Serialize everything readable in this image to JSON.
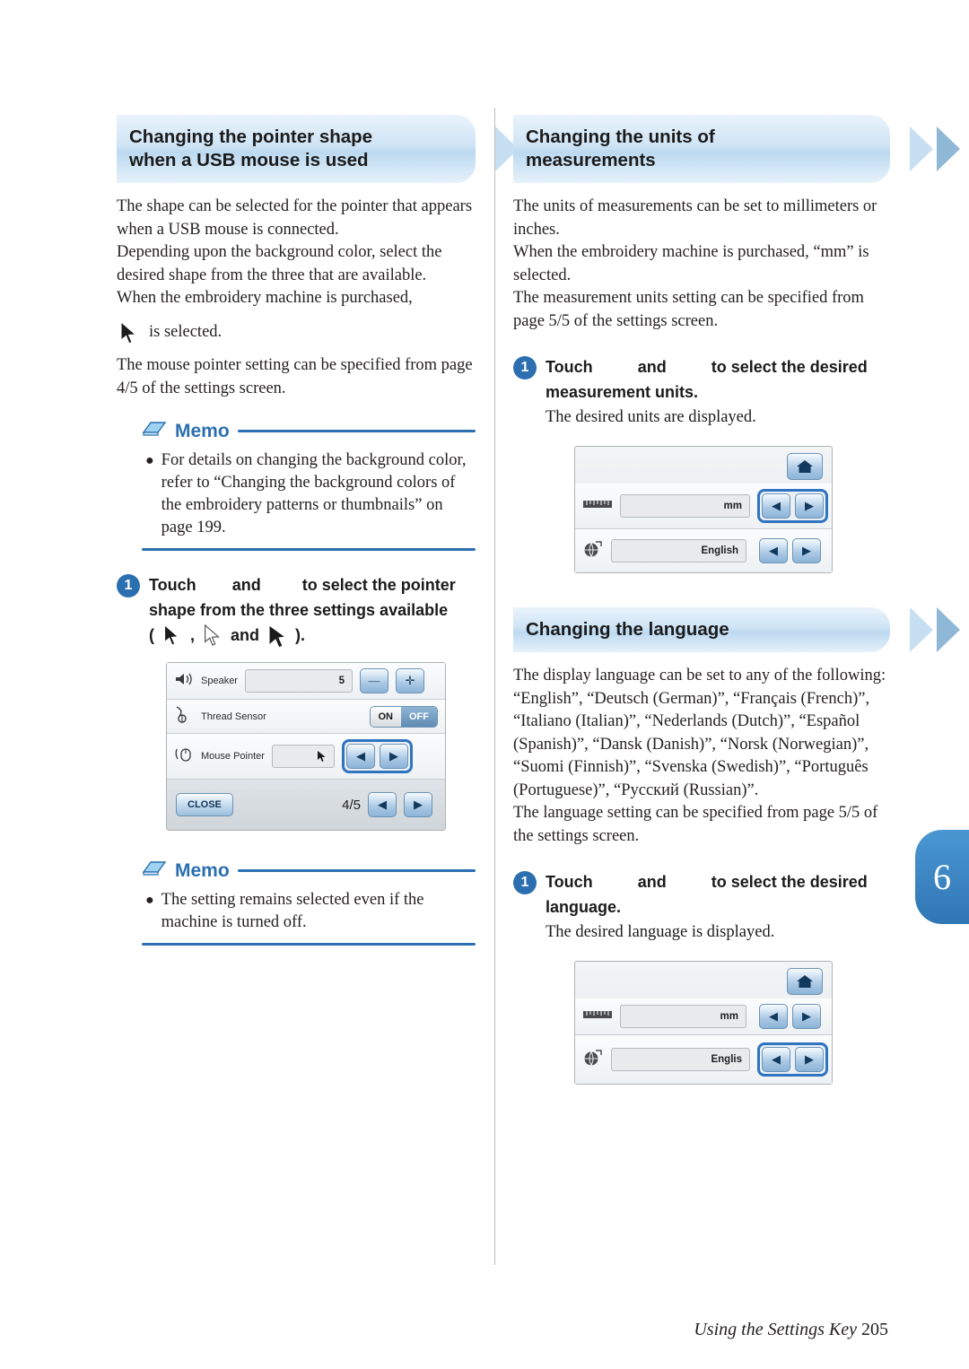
{
  "page": {
    "number": "6",
    "footer_text": "Using the Settings Key",
    "footer_page": "205"
  },
  "left_column": {
    "heading_line1": "Changing the pointer shape",
    "heading_line2": "when a USB mouse is used",
    "paragraphs": [
      "The shape can be selected for the pointer that appears when a USB mouse is connected.",
      "Depending upon the background color, select the desired shape from the three that are available.",
      "When the embroidery machine is purchased,"
    ],
    "is_selected_text": "is selected.",
    "paragraph_after": "The mouse pointer setting can be specified from page 4/5 of the settings screen.",
    "memo1": {
      "title": "Memo",
      "bullet": "For details on changing the background color, refer to “Changing the background colors of the embroidery patterns or thumbnails” on page 199."
    },
    "step1": {
      "number": "1",
      "text_a": "Touch",
      "text_b": "and",
      "text_c": "to select the pointer",
      "text_d": "shape from the three settings available",
      "paren_open": "(",
      "comma": ",",
      "and_word": "and",
      "paren_close": ")."
    },
    "lcd": {
      "rows": [
        {
          "icon": "speaker-icon",
          "label": "Speaker",
          "value": "5",
          "control": "minus-plus"
        },
        {
          "icon": "thread-sensor-icon",
          "label": "Thread Sensor",
          "control": "on-off",
          "on_label": "ON",
          "off_label": "OFF"
        },
        {
          "icon": "mouse-pointer-icon",
          "label": "Mouse Pointer",
          "control": "arrows"
        }
      ],
      "close_label": "CLOSE",
      "page_indicator": "4/5"
    },
    "memo2": {
      "title": "Memo",
      "bullet": "The setting remains selected even if the machine is turned off."
    }
  },
  "right_column": {
    "units_section": {
      "heading_line1": "Changing the units of",
      "heading_line2": "measurements",
      "paragraphs": [
        "The units of measurements can be set to millimeters or inches.",
        "When the embroidery machine is purchased, “mm” is selected.",
        "The measurement units setting can be specified from page 5/5 of the settings screen."
      ],
      "step": {
        "number": "1",
        "text_a": "Touch",
        "text_b": "and",
        "text_c": "to select the desired",
        "text_d": "measurement units.",
        "sub": "The desired units are displayed."
      },
      "lcd": {
        "rows": [
          {
            "icon": "ruler-icon",
            "value": "mm"
          },
          {
            "icon": "globe-icon",
            "value": "English"
          }
        ],
        "selected_row": 0
      }
    },
    "language_section": {
      "heading": "Changing the language",
      "paragraphs": [
        "The display language can be set to any of the following:",
        "“English”, “Deutsch (German)”, “Français (French)”, “Italiano (Italian)”, “Nederlands (Dutch)”, “Español (Spanish)”, “Dansk (Danish)”, “Norsk (Norwegian)”, “Suomi (Finnish)”, “Svenska (Swedish)”, “Português (Portuguese)”, “Русский (Russian)”.",
        "The language setting can be specified from page 5/5 of the settings screen."
      ],
      "step": {
        "number": "1",
        "text_a": "Touch",
        "text_b": "and",
        "text_c": "to select the desired",
        "text_d": "language.",
        "sub": "The desired language is displayed."
      },
      "lcd": {
        "rows": [
          {
            "icon": "ruler-icon",
            "value": "mm"
          },
          {
            "icon": "globe-icon",
            "value": "Englis"
          }
        ],
        "selected_row": 1
      }
    }
  },
  "icons": {
    "arrow_left": "◀",
    "arrow_right": "▶",
    "minus": "—",
    "plus": "✛",
    "home": "home-icon"
  },
  "colors": {
    "accent": "#2b6fb0",
    "heading_bg": "#cfe4f5",
    "tab": "#3d88c6"
  }
}
